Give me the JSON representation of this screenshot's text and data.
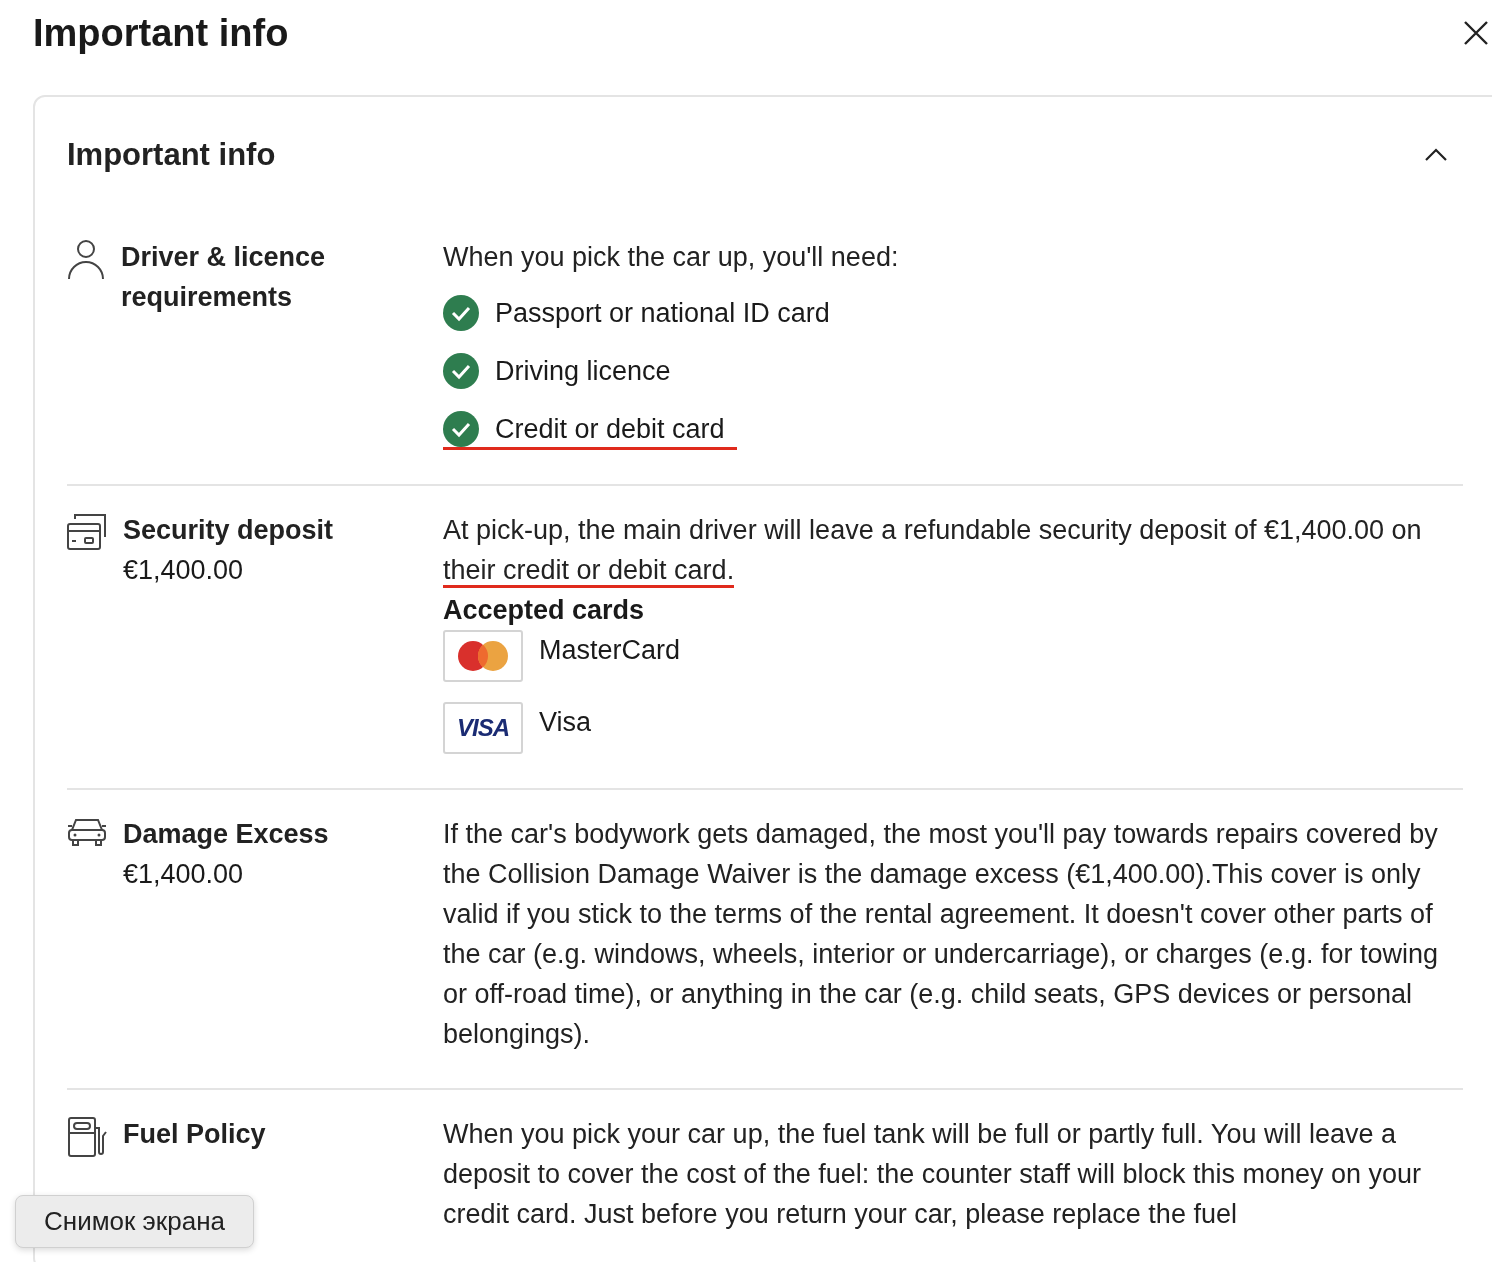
{
  "dialog": {
    "title": "Important info"
  },
  "panel": {
    "title": "Important info",
    "expanded": true
  },
  "sections": [
    {
      "kind": "requirements",
      "title": "Driver & licence requirements",
      "intro": "When you pick the car up, you'll need:",
      "items": [
        {
          "text": "Passport or national ID card",
          "checked": true,
          "annotated": false
        },
        {
          "text": "Driving licence",
          "checked": true,
          "annotated": false
        },
        {
          "text": "Credit or debit card",
          "checked": true,
          "annotated": true
        }
      ]
    },
    {
      "kind": "deposit",
      "title": "Security deposit",
      "subtitle": "€1,400.00",
      "text": "At pick-up, the main driver will leave a refundable security deposit of €1,400.00 on ",
      "text_annotated": "their credit or debit card.",
      "cards_heading": "Accepted cards",
      "cards": [
        {
          "kind": "mastercard",
          "name": "MasterCard"
        },
        {
          "kind": "visa",
          "logo_text": "VISA",
          "name": "Visa"
        }
      ]
    },
    {
      "kind": "text",
      "title": "Damage Excess",
      "subtitle": "€1,400.00",
      "text": "If the car's bodywork gets damaged, the most you'll pay towards repairs covered by the Collision Damage Waiver is the damage excess (€1,400.00).This cover is only valid if you stick to the terms of the rental agreement. It doesn't cover other parts of the car (e.g. windows, wheels, interior or undercarriage), or charges (e.g. for towing or off-road time), or anything in the car (e.g. child seats, GPS devices or personal belongings)."
    },
    {
      "kind": "text",
      "title": "Fuel Policy",
      "text": "When you pick your car up, the fuel tank will be full or partly full. You will leave a deposit to cover the cost of the fuel: the counter staff will block this money on your credit card. Just before you return your car, please replace the fuel"
    }
  ],
  "tooltip": {
    "text": "Снимок экрана"
  }
}
